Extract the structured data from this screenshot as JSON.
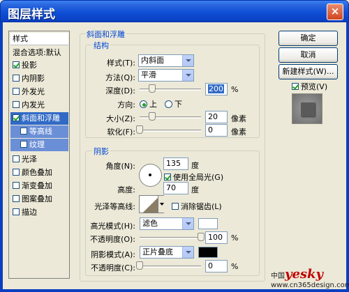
{
  "window": {
    "title": "图层样式",
    "close_glyph": "×"
  },
  "left_panel": {
    "header": "样式",
    "blend": "混合选项:默认",
    "items": [
      {
        "label": "投影",
        "checked": true
      },
      {
        "label": "内阴影",
        "checked": false
      },
      {
        "label": "外发光",
        "checked": false
      },
      {
        "label": "内发光",
        "checked": false
      },
      {
        "label": "斜面和浮雕",
        "checked": true,
        "selected": true
      },
      {
        "label": "等高线",
        "checked": false,
        "sub": true
      },
      {
        "label": "纹理",
        "checked": false,
        "sub": true
      },
      {
        "label": "光泽",
        "checked": false
      },
      {
        "label": "颜色叠加",
        "checked": false
      },
      {
        "label": "渐变叠加",
        "checked": false
      },
      {
        "label": "图案叠加",
        "checked": false
      },
      {
        "label": "描边",
        "checked": false
      }
    ]
  },
  "bevel": {
    "section_title": "斜面和浮雕",
    "structure_title": "结构",
    "style_label": "样式(T):",
    "style_value": "内斜面",
    "technique_label": "方法(Q):",
    "technique_value": "平滑",
    "depth_label": "深度(D):",
    "depth_value": "200",
    "depth_unit": "%",
    "depth_slider": 0.2,
    "direction_label": "方向:",
    "direction_up": "上",
    "direction_down": "下",
    "size_label": "大小(Z):",
    "size_value": "20",
    "size_unit": "像素",
    "size_slider": 0.2,
    "soften_label": "软化(F):",
    "soften_value": "0",
    "soften_unit": "像素",
    "soften_slider": 0.0
  },
  "shading": {
    "title": "阴影",
    "angle_label": "角度(N):",
    "angle_value": "135",
    "angle_unit": "度",
    "global_light_label": "使用全局光(G)",
    "altitude_label": "高度:",
    "altitude_value": "70",
    "altitude_unit": "度",
    "gloss_label": "光泽等高线:",
    "antialias_label": "消除锯齿(L)",
    "highlight_mode_label": "高光模式(H):",
    "highlight_mode_value": "滤色",
    "highlight_color": "#ffffff",
    "highlight_opacity_label": "不透明度(O):",
    "highlight_opacity_value": "100",
    "highlight_opacity_unit": "%",
    "highlight_opacity_slider": 1.0,
    "shadow_mode_label": "阴影模式(A):",
    "shadow_mode_value": "正片叠底",
    "shadow_color": "#000000",
    "shadow_opacity_label": "不透明度(C):",
    "shadow_opacity_value": "0",
    "shadow_opacity_unit": "%",
    "shadow_opacity_slider": 0.0
  },
  "buttons": {
    "ok": "确定",
    "cancel": "取消",
    "new_style": "新建样式(W)...",
    "preview_label": "预览(V)"
  },
  "watermark": {
    "brand": "yesky",
    "prefix": "中国",
    "line2": "www.cn365design.com"
  },
  "colors": {
    "accent": "#0a3fc0",
    "selection": "#316ac5",
    "group_title": "#0046d5"
  }
}
